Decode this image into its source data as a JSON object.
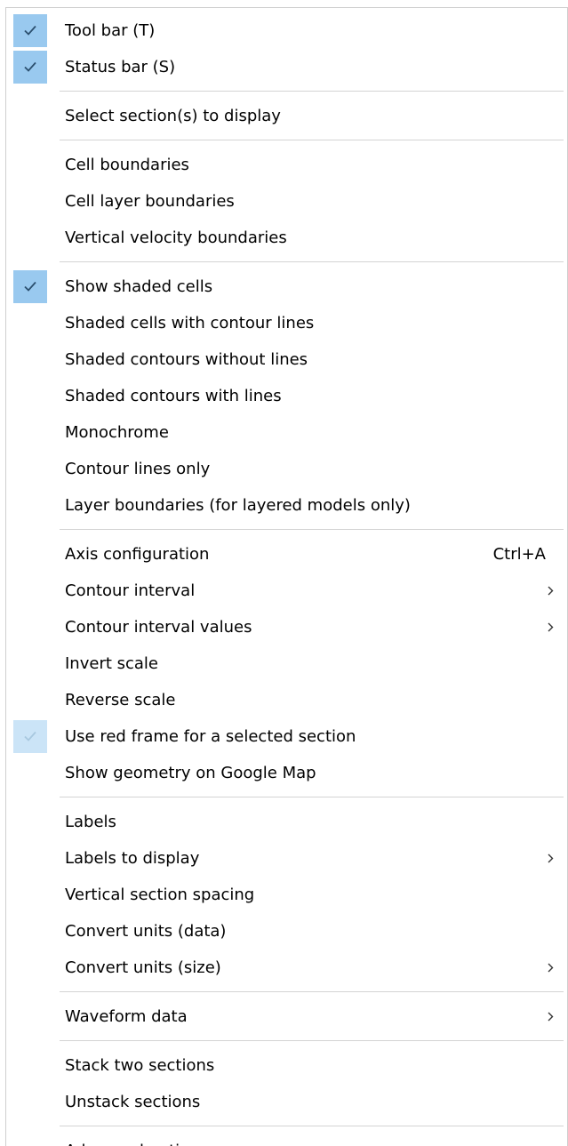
{
  "colors": {
    "checked_bg": "#99c9ef",
    "checked_disabled_bg": "#cbe4f7",
    "separator": "#d4d4d4",
    "text": "#000000"
  },
  "menu": {
    "groups": [
      [
        {
          "label": "Tool bar (T)",
          "checked": true
        },
        {
          "label": "Status bar (S)",
          "checked": true
        }
      ],
      [
        {
          "label": "Select section(s) to display"
        }
      ],
      [
        {
          "label": "Cell boundaries"
        },
        {
          "label": "Cell layer boundaries"
        },
        {
          "label": "Vertical velocity boundaries"
        }
      ],
      [
        {
          "label": "Show shaded cells",
          "checked": true
        },
        {
          "label": "Shaded cells with contour lines"
        },
        {
          "label": "Shaded contours without lines"
        },
        {
          "label": "Shaded contours with lines"
        },
        {
          "label": "Monochrome"
        },
        {
          "label": "Contour lines only"
        },
        {
          "label": "Layer boundaries (for layered models only)"
        }
      ],
      [
        {
          "label": "Axis configuration",
          "shortcut": "Ctrl+A"
        },
        {
          "label": "Contour interval",
          "submenu": true
        },
        {
          "label": "Contour interval values",
          "submenu": true
        },
        {
          "label": "Invert scale"
        },
        {
          "label": "Reverse scale"
        },
        {
          "label": "Use red frame for a selected section",
          "checked": true,
          "check_disabled": true
        },
        {
          "label": "Show geometry on Google Map"
        }
      ],
      [
        {
          "label": "Labels"
        },
        {
          "label": "Labels to display",
          "submenu": true
        },
        {
          "label": "Vertical section spacing"
        },
        {
          "label": "Convert units (data)"
        },
        {
          "label": "Convert units (size)",
          "submenu": true
        }
      ],
      [
        {
          "label": "Waveform data",
          "submenu": true
        }
      ],
      [
        {
          "label": "Stack two sections"
        },
        {
          "label": "Unstack sections"
        }
      ],
      [
        {
          "label": "Advanced options",
          "submenu": true
        }
      ]
    ],
    "icons": {
      "check": "check-icon",
      "submenu": "chevron-right-icon"
    }
  }
}
